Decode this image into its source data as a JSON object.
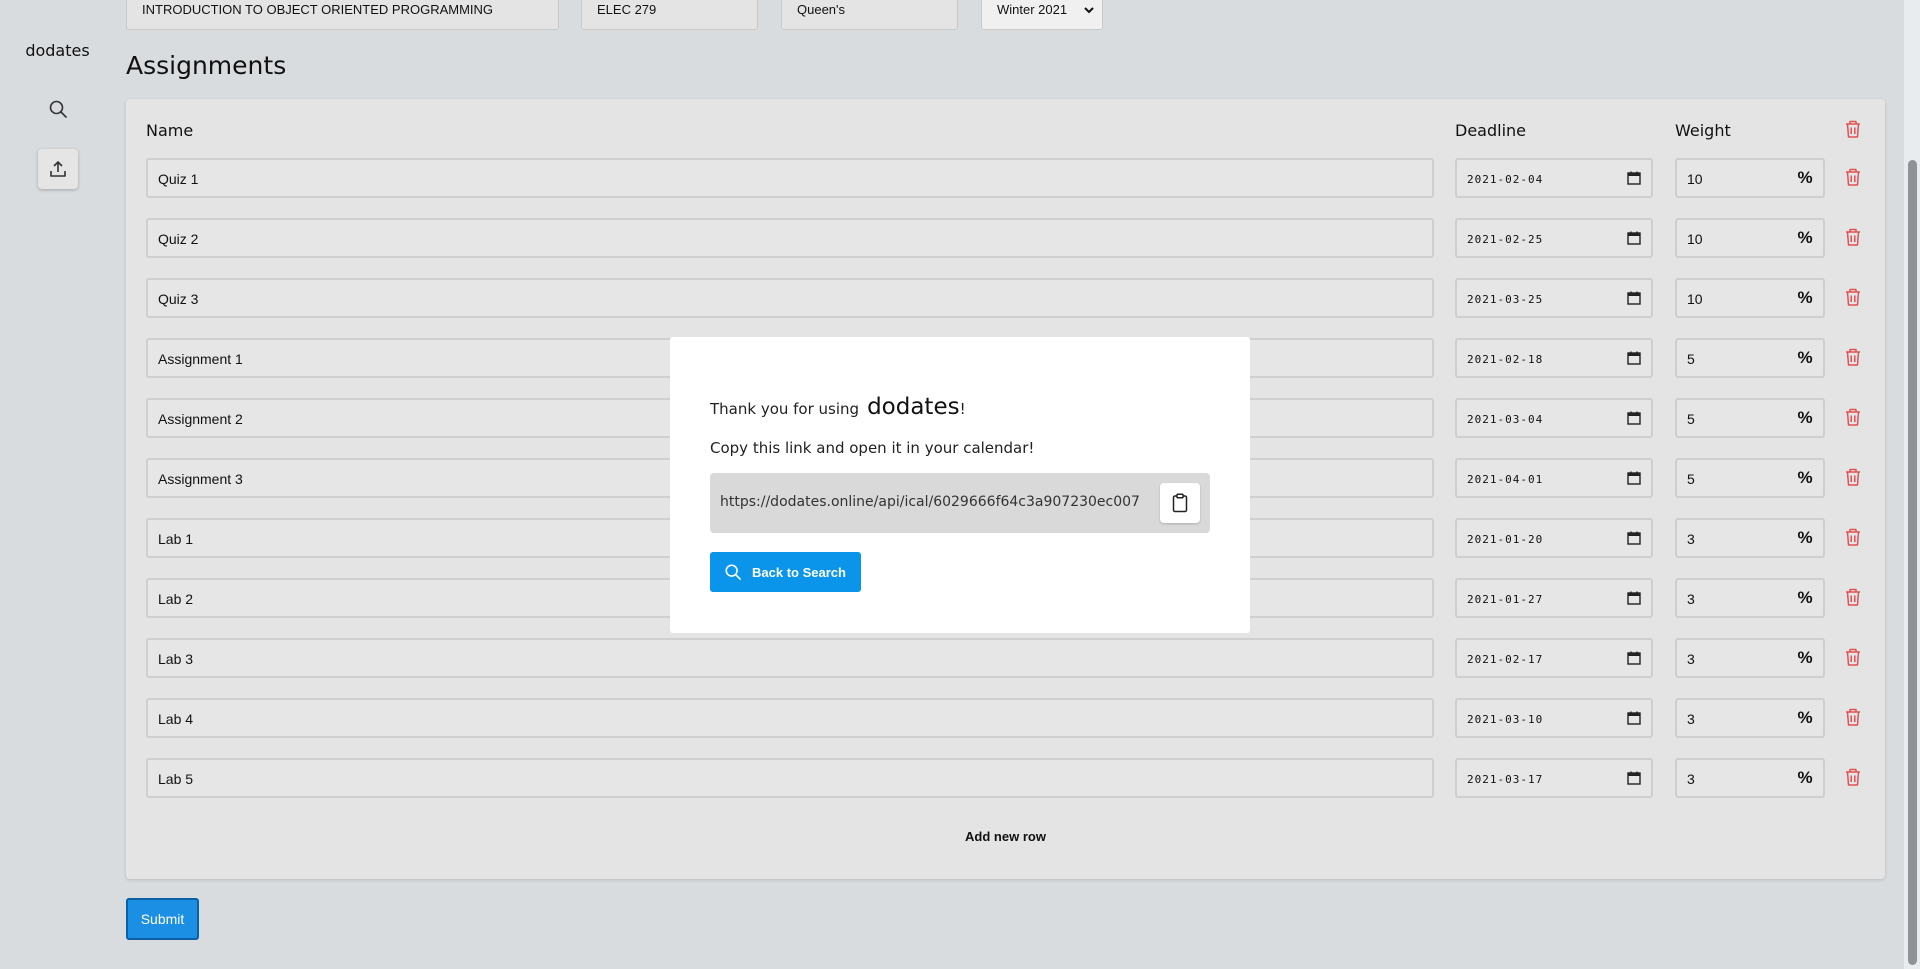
{
  "app": {
    "brand": "dodates"
  },
  "course": {
    "name": "INTRODUCTION TO OBJECT ORIENTED PROGRAMMING",
    "code": "ELEC 279",
    "school": "Queen's",
    "term": "Winter 2021"
  },
  "assignments": {
    "title": "Assignments",
    "headers": {
      "name": "Name",
      "deadline": "Deadline",
      "weight": "Weight"
    },
    "rows": [
      {
        "name": "Quiz 1",
        "deadline": "2021-02-04",
        "weight": "10"
      },
      {
        "name": "Quiz 2",
        "deadline": "2021-02-25",
        "weight": "10"
      },
      {
        "name": "Quiz 3",
        "deadline": "2021-03-25",
        "weight": "10"
      },
      {
        "name": "Assignment 1",
        "deadline": "2021-02-18",
        "weight": "5"
      },
      {
        "name": "Assignment 2",
        "deadline": "2021-03-04",
        "weight": "5"
      },
      {
        "name": "Assignment 3",
        "deadline": "2021-04-01",
        "weight": "5"
      },
      {
        "name": "Lab 1",
        "deadline": "2021-01-20",
        "weight": "3"
      },
      {
        "name": "Lab 2",
        "deadline": "2021-01-27",
        "weight": "3"
      },
      {
        "name": "Lab 3",
        "deadline": "2021-02-17",
        "weight": "3"
      },
      {
        "name": "Lab 4",
        "deadline": "2021-03-10",
        "weight": "3"
      },
      {
        "name": "Lab 5",
        "deadline": "2021-03-17",
        "weight": "3"
      }
    ],
    "percent_symbol": "%",
    "add_row_label": "Add new row"
  },
  "submit_label": "Submit",
  "modal": {
    "thanks_prefix": "Thank you for using",
    "thanks_brand": "dodates",
    "thanks_suffix": "!",
    "copy_instruction": "Copy this link and open it in your calendar!",
    "link": "https://dodates.online/api/ical/6029666f64c3a907230ec007",
    "back_label": "Back to Search"
  },
  "icons": {
    "sidebar": [
      "search-icon",
      "upload-icon"
    ],
    "row": [
      "calendar-icon",
      "trash-icon"
    ],
    "modal": [
      "clipboard-icon",
      "search-icon"
    ]
  },
  "colors": {
    "accent": "#0a94ea",
    "danger": "#e05252",
    "background": "#d9dcdf",
    "card": "#e4e4e4"
  }
}
